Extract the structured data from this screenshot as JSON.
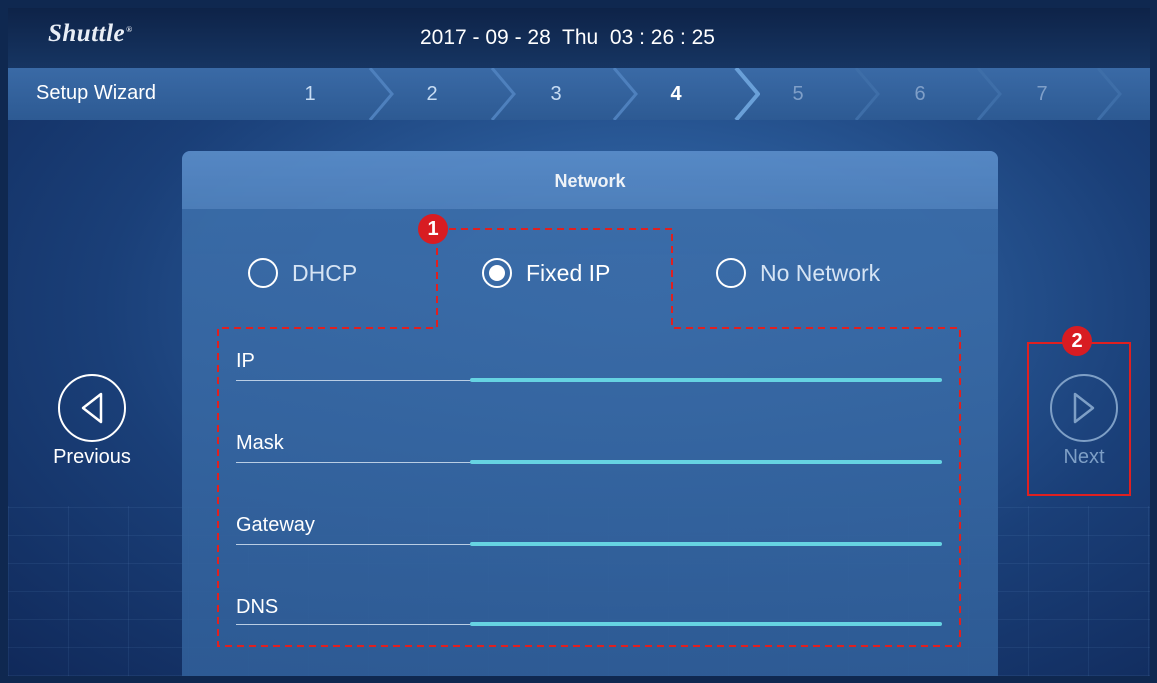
{
  "header": {
    "logo": "Shuttle",
    "datetime": "2017 - 09 - 28  Thu  03 : 26 : 25"
  },
  "wizard": {
    "title": "Setup Wizard",
    "steps": [
      "1",
      "2",
      "3",
      "4",
      "5",
      "6",
      "7"
    ],
    "current_step": 4
  },
  "panel": {
    "title": "Network",
    "options": [
      {
        "label": "DHCP",
        "selected": false
      },
      {
        "label": "Fixed IP",
        "selected": true
      },
      {
        "label": "No Network",
        "selected": false
      }
    ],
    "fields": [
      {
        "label": "IP",
        "value": ""
      },
      {
        "label": "Mask",
        "value": ""
      },
      {
        "label": "Gateway",
        "value": ""
      },
      {
        "label": "DNS",
        "value": ""
      }
    ]
  },
  "nav": {
    "previous": "Previous",
    "next": "Next",
    "previous_icon": "chevron-left-circle-icon",
    "next_icon": "chevron-right-circle-icon"
  },
  "annotations": [
    "1",
    "2"
  ],
  "colors": {
    "accent_line": "#66d3e2",
    "annotation_red": "#e02020",
    "badge_red": "#d81c22"
  }
}
